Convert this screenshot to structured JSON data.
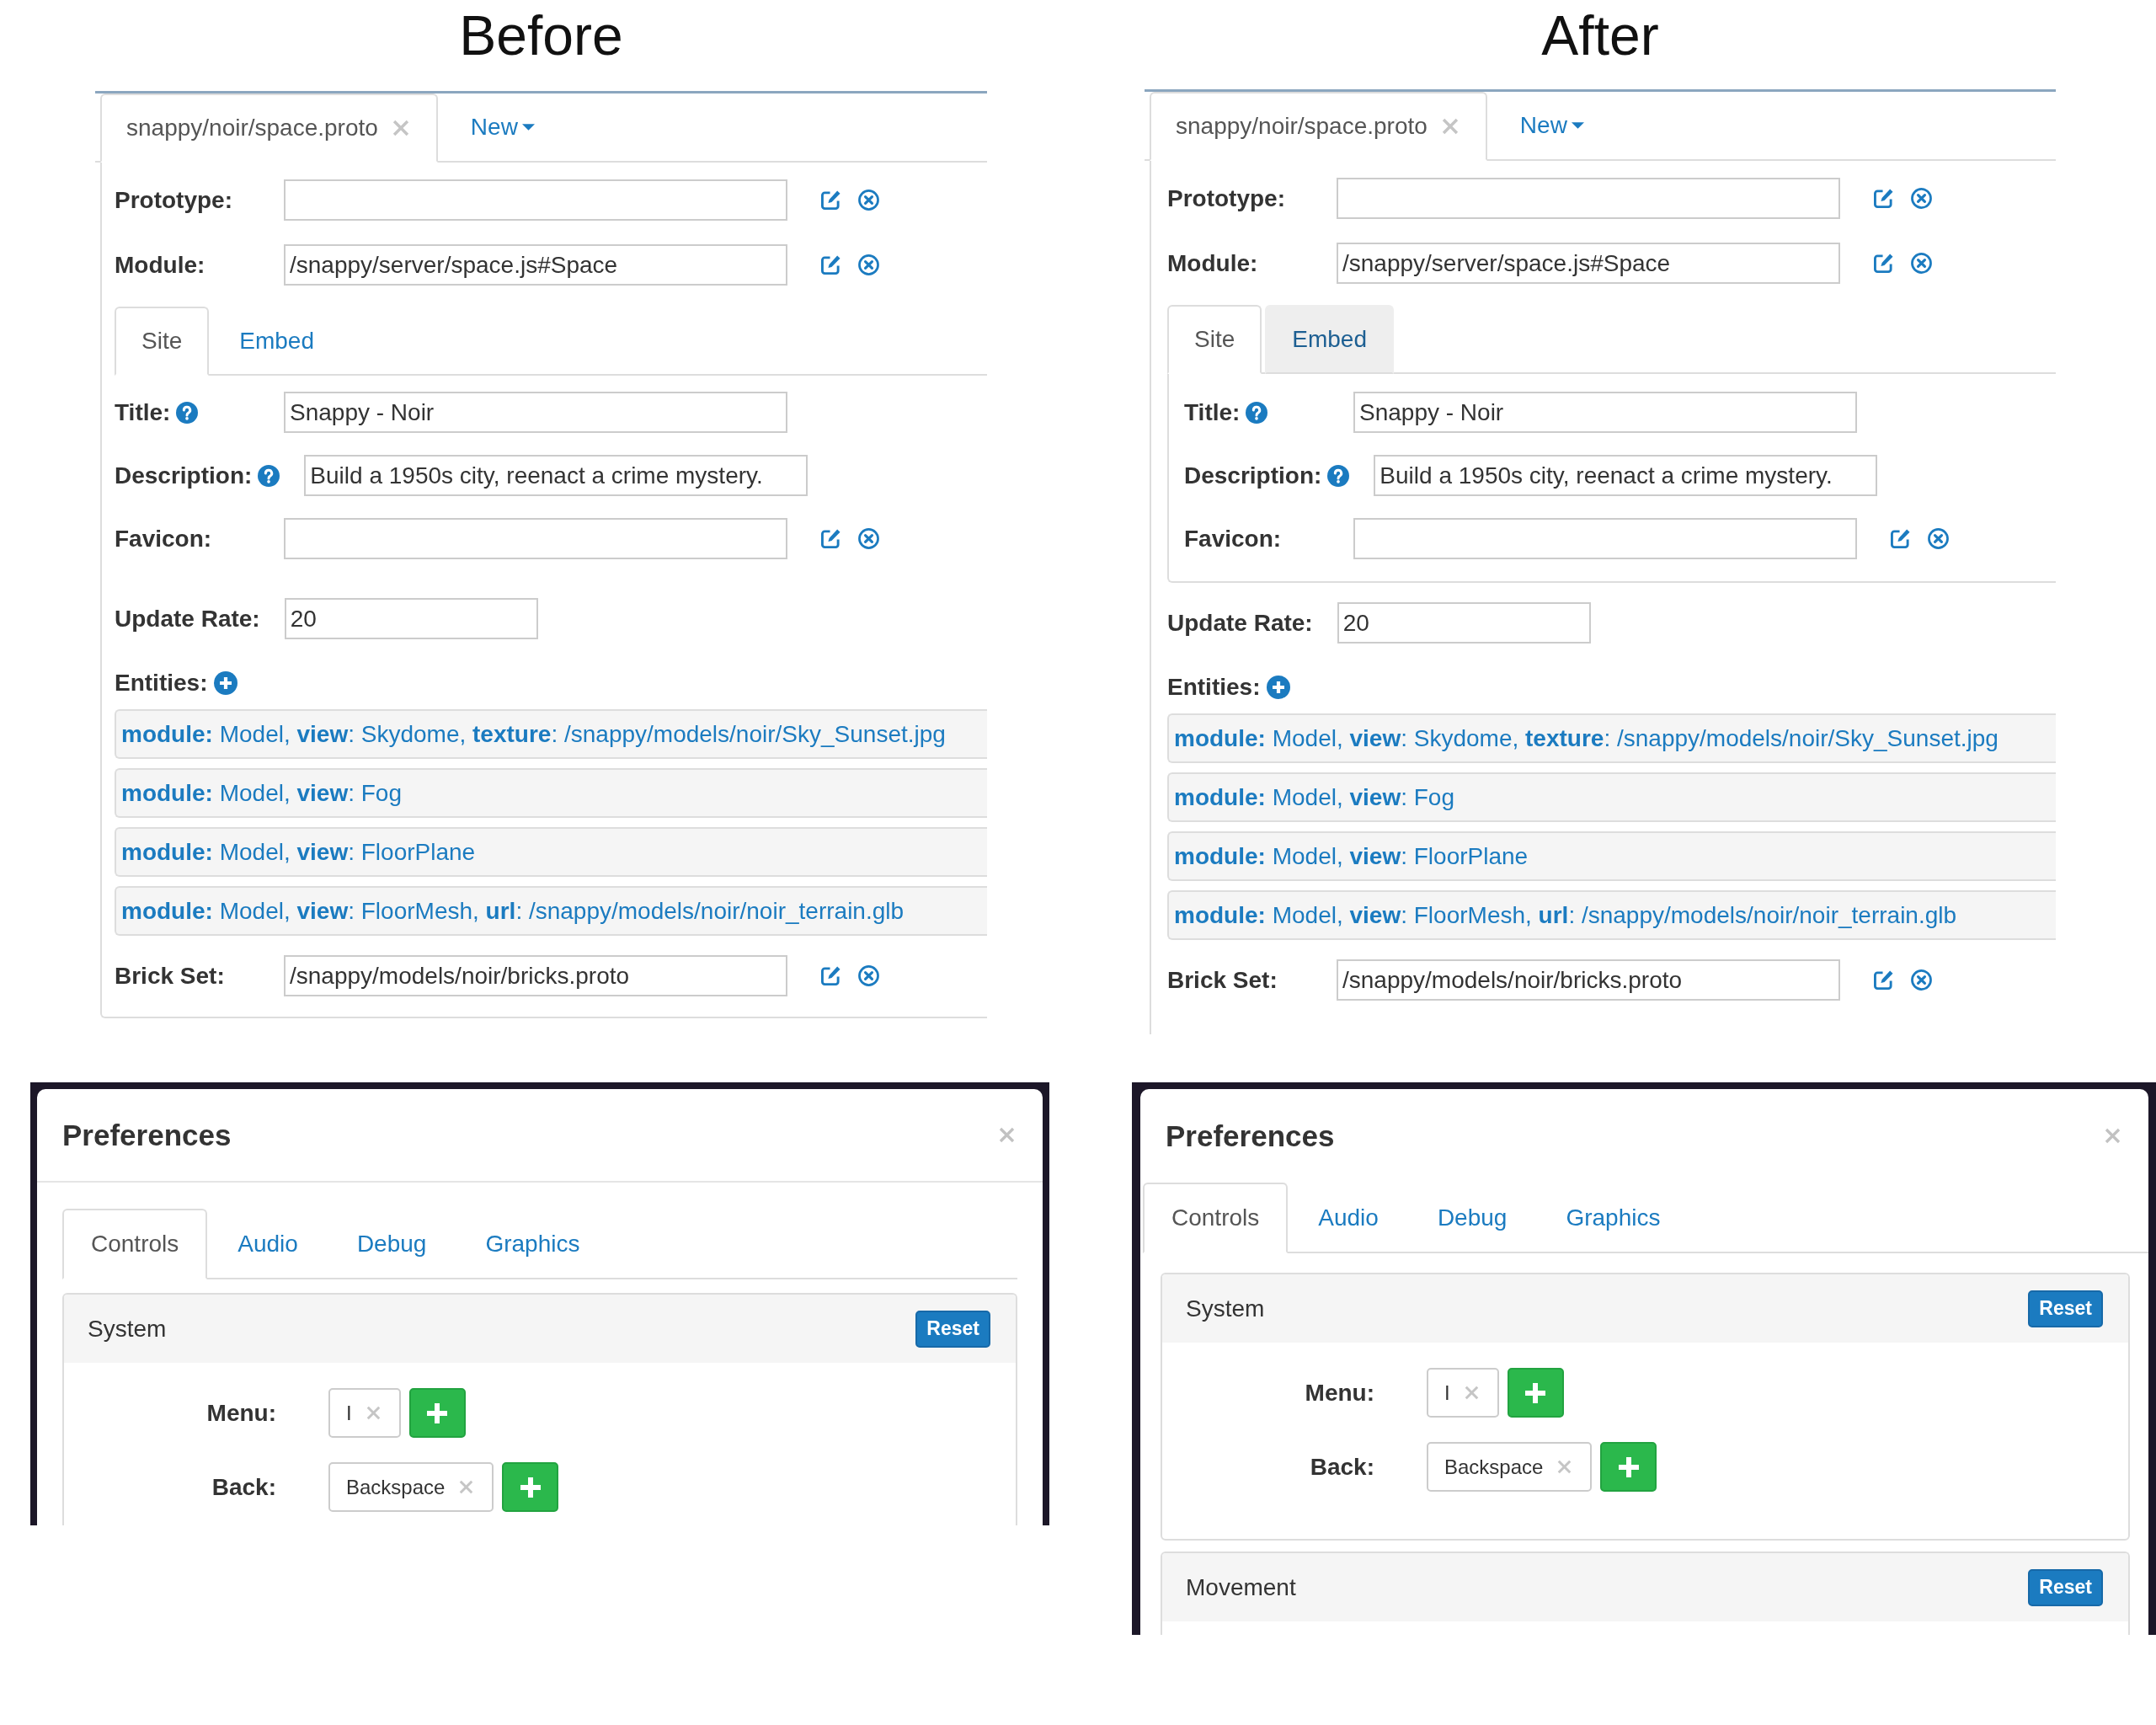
{
  "comparison": [
    {
      "kind": "before",
      "heading": "Before",
      "editor": {
        "file_tabs": [
          {
            "label": "snappy/noir/space.proto",
            "selected": true
          }
        ],
        "new_menu": "New",
        "fields": [
          {
            "label": "Prototype:",
            "kind": "path"
          },
          {
            "label": "Module:",
            "value": "/snappy/server/space.js#Space",
            "kind": "path"
          }
        ],
        "site_tabs": [
          {
            "label": "Site",
            "selected": true,
            "hovered": false
          },
          {
            "label": "Embed",
            "selected": false,
            "hovered": false
          }
        ],
        "site_fields": [
          {
            "label": "Title:",
            "value": "Snappy - Noir",
            "kind": "help"
          },
          {
            "label": "Description:",
            "value": "Build a 1950s city, reenact a crime mystery.",
            "kind": "help"
          },
          {
            "label": "Favicon:",
            "kind": "path"
          }
        ],
        "settings": [
          {
            "label": "Update Rate:",
            "value": "20",
            "kind": "short"
          }
        ],
        "entities": {
          "label": "Entities:",
          "items": [
            "**module:** Model, **view**: Skydome, **texture**: /snappy/models/noir/Sky_Sunset.jpg",
            "**module:** Model, **view**: Fog",
            "**module:** Model, **view**: FloorPlane",
            "**module:** Model, **view**: FloorMesh, **url**: /snappy/models/noir/noir_terrain.glb"
          ]
        },
        "extra_fields": [
          {
            "label": "Brick Set:",
            "value": "/snappy/models/noir/bricks.proto",
            "kind": "path"
          }
        ]
      },
      "preferences": {
        "title": "Preferences",
        "tabs": [
          {
            "label": "Controls",
            "selected": true
          },
          {
            "label": "Audio",
            "selected": false
          },
          {
            "label": "Debug",
            "selected": false
          },
          {
            "label": "Graphics",
            "selected": false
          }
        ],
        "sections": [
          {
            "title": "System",
            "reset": "Reset",
            "bindings": [
              {
                "label": "Menu:",
                "keys": [
                  "I"
                ]
              },
              {
                "label": "Back:",
                "keys": [
                  "Backspace"
                ]
              }
            ]
          }
        ]
      }
    },
    {
      "kind": "after",
      "heading": "After",
      "editor": {
        "file_tabs": [
          {
            "label": "snappy/noir/space.proto",
            "selected": true
          }
        ],
        "new_menu": "New",
        "fields": [
          {
            "label": "Prototype:",
            "kind": "path"
          },
          {
            "label": "Module:",
            "value": "/snappy/server/space.js#Space",
            "kind": "path"
          }
        ],
        "site_tabs": [
          {
            "label": "Site",
            "selected": true,
            "hovered": false
          },
          {
            "label": "Embed",
            "selected": false,
            "hovered": true
          }
        ],
        "site_fields": [
          {
            "label": "Title:",
            "value": "Snappy - Noir",
            "kind": "help"
          },
          {
            "label": "Description:",
            "value": "Build a 1950s city, reenact a crime mystery.",
            "kind": "help"
          },
          {
            "label": "Favicon:",
            "kind": "path"
          }
        ],
        "settings": [
          {
            "label": "Update Rate:",
            "value": "20",
            "kind": "short"
          }
        ],
        "entities": {
          "label": "Entities:",
          "items": [
            "**module:** Model, **view**: Skydome, **texture**: /snappy/models/noir/Sky_Sunset.jpg",
            "**module:** Model, **view**: Fog",
            "**module:** Model, **view**: FloorPlane",
            "**module:** Model, **view**: FloorMesh, **url**: /snappy/models/noir/noir_terrain.glb"
          ]
        },
        "extra_fields": [
          {
            "label": "Brick Set:",
            "value": "/snappy/models/noir/bricks.proto",
            "kind": "path"
          }
        ]
      },
      "preferences": {
        "title": "Preferences",
        "tabs": [
          {
            "label": "Controls",
            "selected": true
          },
          {
            "label": "Audio",
            "selected": false
          },
          {
            "label": "Debug",
            "selected": false
          },
          {
            "label": "Graphics",
            "selected": false
          }
        ],
        "sections": [
          {
            "title": "System",
            "reset": "Reset",
            "bindings": [
              {
                "label": "Menu:",
                "keys": [
                  "I"
                ]
              },
              {
                "label": "Back:",
                "keys": [
                  "Backspace"
                ]
              }
            ]
          },
          {
            "title": "Movement",
            "reset": "Reset"
          }
        ]
      }
    }
  ]
}
